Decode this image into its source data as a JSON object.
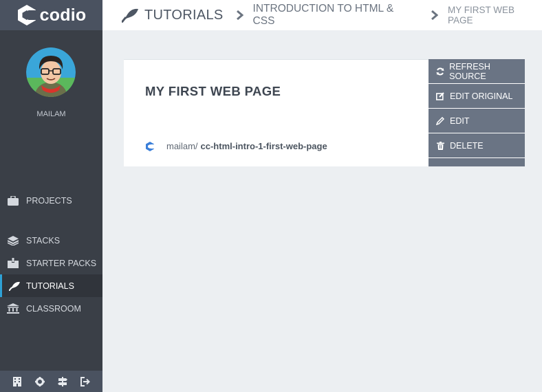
{
  "app": {
    "brand": "codio",
    "accent_color": "#2ea1d6",
    "sidebar_color": "#3a3f47",
    "action_color": "#6a7484"
  },
  "user": {
    "name": "MAILAM"
  },
  "nav": {
    "items": [
      {
        "label": "PROJECTS",
        "icon": "briefcase-icon"
      },
      {
        "label": "STACKS",
        "icon": "layers-icon"
      },
      {
        "label": "STARTER PACKS",
        "icon": "box-icon"
      },
      {
        "label": "TUTORIALS",
        "icon": "tutorial-icon",
        "active": true
      },
      {
        "label": "CLASSROOM",
        "icon": "classroom-icon"
      }
    ]
  },
  "footer": {
    "icons": [
      "building-icon",
      "gear-icon",
      "signpost-icon",
      "logout-icon"
    ]
  },
  "breadcrumb": {
    "section": "TUTORIALS",
    "parent": "INTRODUCTION TO HTML & CSS",
    "current": "MY FIRST WEB PAGE"
  },
  "tutorial": {
    "title": "MY FIRST WEB PAGE",
    "owner": "mailam/",
    "repo": "cc-html-intro-1-first-web-page"
  },
  "actions": {
    "refresh": "REFRESH SOURCE",
    "edit_original": "EDIT ORIGINAL",
    "edit": "EDIT",
    "delete": "DELETE"
  }
}
